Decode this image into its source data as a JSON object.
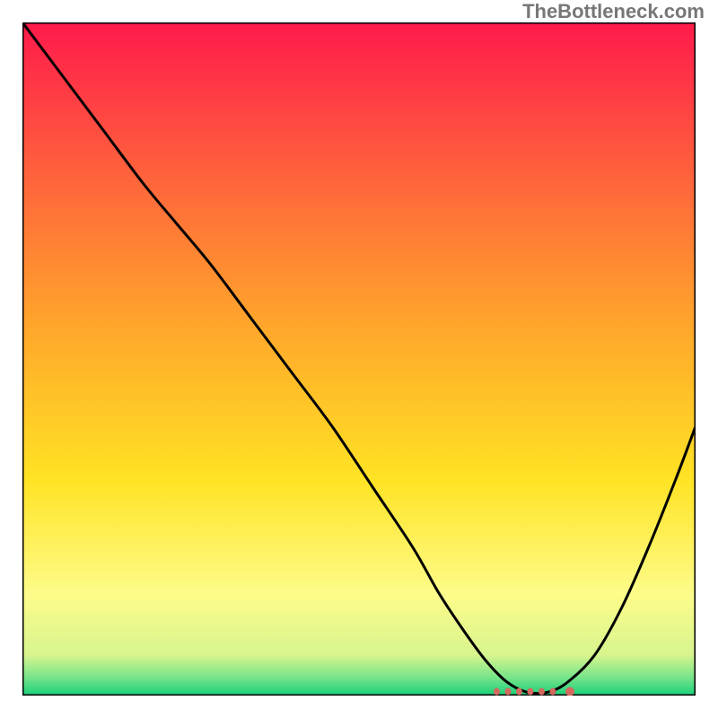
{
  "watermark": "TheBottleneck.com",
  "chart_data": {
    "type": "line",
    "title": "",
    "xlabel": "",
    "ylabel": "",
    "xlim": [
      0,
      100
    ],
    "ylim": [
      0,
      100
    ],
    "grid": false,
    "legend": false,
    "annotations": [],
    "background_gradient": {
      "stops": [
        {
          "pos": 0.0,
          "color": "#ff1a4b"
        },
        {
          "pos": 0.2,
          "color": "#ff5a3e"
        },
        {
          "pos": 0.45,
          "color": "#ffa62b"
        },
        {
          "pos": 0.68,
          "color": "#ffe324"
        },
        {
          "pos": 0.85,
          "color": "#fdfc8a"
        },
        {
          "pos": 0.94,
          "color": "#d7f58e"
        },
        {
          "pos": 0.975,
          "color": "#71e389"
        },
        {
          "pos": 1.0,
          "color": "#18cf7a"
        }
      ]
    },
    "series": [
      {
        "name": "bottleneck-curve",
        "color": "#000000",
        "x": [
          0,
          6,
          12,
          18,
          23,
          28,
          34,
          40,
          46,
          52,
          58,
          62,
          66,
          69,
          72,
          75,
          78,
          81,
          85,
          89,
          93,
          97,
          100
        ],
        "y": [
          100,
          92,
          84,
          76,
          70,
          64,
          56,
          48,
          40,
          31,
          22,
          15,
          9,
          5,
          2,
          0.5,
          0.5,
          2,
          6,
          13,
          22,
          32,
          40
        ]
      }
    ],
    "minimum_marker": {
      "name": "minimum-region",
      "color": "#d46a5f",
      "x_range": [
        70,
        80
      ],
      "y": 0.6
    }
  }
}
